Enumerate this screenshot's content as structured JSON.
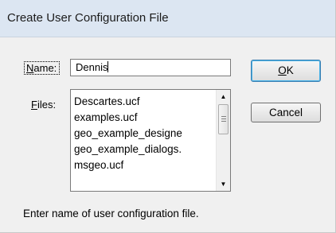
{
  "window": {
    "title": "Create User Configuration File"
  },
  "name_field": {
    "label_hotkey": "N",
    "label_rest": "ame:",
    "value": "Dennis"
  },
  "files": {
    "label_hotkey": "F",
    "label_rest": "iles:",
    "items": [
      "Descartes.ucf",
      "examples.ucf",
      "geo_example_designe",
      "geo_example_dialogs.",
      "msgeo.ucf"
    ]
  },
  "buttons": {
    "ok_hotkey": "O",
    "ok_rest": "K",
    "cancel": "Cancel"
  },
  "status": "Enter name of user configuration file.",
  "scrollbar": {
    "up_icon": "arrow-up-icon",
    "down_icon": "arrow-down-icon"
  }
}
